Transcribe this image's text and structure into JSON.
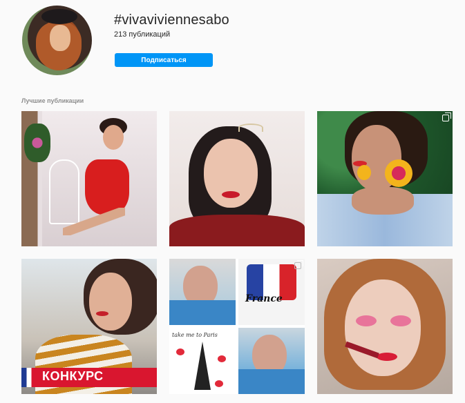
{
  "header": {
    "hashtag": "#vivaviviennesabo",
    "post_count": "213 публикаций",
    "subscribe_label": "Подписаться"
  },
  "section": {
    "label": "Лучшие публикации"
  },
  "posts": [
    {
      "subject": "woman in red dress seated on white chair",
      "multi": false
    },
    {
      "subject": "woman with tiara, red lips",
      "multi": false
    },
    {
      "subject": "woman with yellow tassel earrings",
      "multi": true
    },
    {
      "subject": "woman in striped shirt",
      "multi": false,
      "banner": "КОНКУРС"
    },
    {
      "subject": "collage with France theme",
      "multi": true,
      "texts": [
        "France",
        "take me to Paris"
      ]
    },
    {
      "subject": "woman with pink eye makeup holding lip gloss",
      "multi": false
    }
  ],
  "colors": {
    "accent": "#0095f6",
    "background": "#fafafa",
    "banner_red": "#d9162f"
  }
}
